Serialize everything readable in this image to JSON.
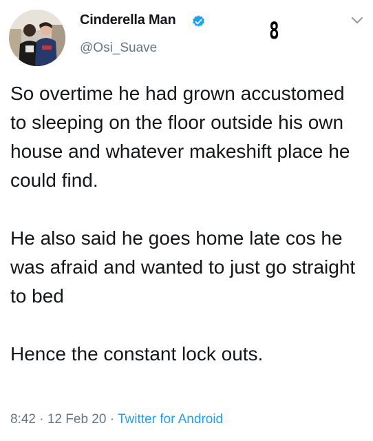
{
  "tweet": {
    "display_name": "Cinderella Man",
    "handle": "@Osi_Suave",
    "overlay_number": "8",
    "paragraphs": [
      "So overtime he had grown accustomed to sleeping  on the floor outside his own house and whatever makeshift place he could find.",
      "He also said he goes home late cos he was afraid and wanted to just go straight to bed",
      "Hence the constant lock outs."
    ],
    "time": "8:42",
    "separator_1": " · ",
    "date": "12 Feb 20",
    "separator_2": " · ",
    "source": "Twitter for Android"
  },
  "icons": {
    "verified": "verified-badge-icon",
    "menu": "chevron-down-icon"
  },
  "colors": {
    "text": "#14171a",
    "secondary_text": "#657786",
    "accent": "#1da1f2"
  }
}
